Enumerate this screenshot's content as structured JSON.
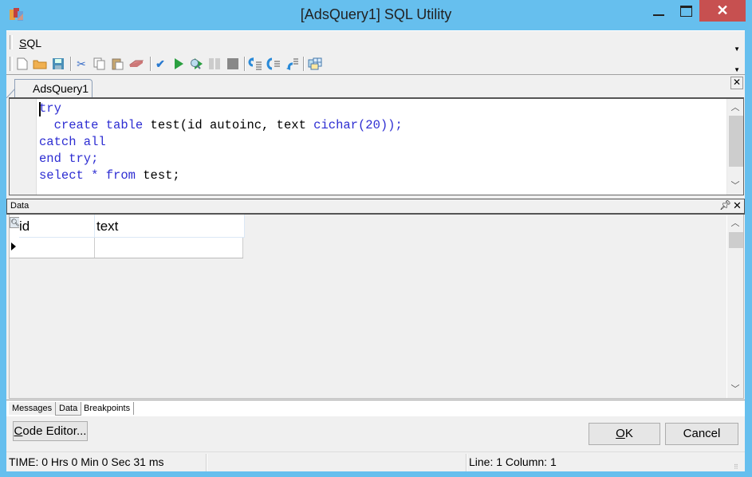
{
  "window": {
    "title": "[AdsQuery1] SQL Utility",
    "controls": {
      "minimize": "minimize",
      "maximize": "maximize",
      "close": "✕"
    }
  },
  "menu": {
    "sql_label": "SQL",
    "sql_accel": "S",
    "sql_rest": "QL"
  },
  "toolbar": {
    "groups": [
      [
        "new-file",
        "open-folder",
        "save"
      ],
      [
        "cut",
        "copy",
        "paste",
        "eraser"
      ],
      [
        "verify",
        "run",
        "run-debug",
        "pause",
        "stop"
      ],
      [
        "step-into",
        "step-over",
        "step-out"
      ],
      [
        "table-grid"
      ]
    ]
  },
  "tabs": {
    "active": "AdsQuery1"
  },
  "editor": {
    "lines": [
      [
        {
          "t": "try",
          "k": true
        }
      ],
      [
        {
          "t": "  "
        },
        {
          "t": "create table",
          "k": true
        },
        {
          "t": " test(id autoinc, text "
        },
        {
          "t": "cichar(20));",
          "k": true
        }
      ],
      [
        {
          "t": "catch all",
          "k": true
        }
      ],
      [
        {
          "t": "end try;",
          "k": true
        }
      ],
      [
        {
          "t": "select * from",
          "k": true
        },
        {
          "t": " test;"
        }
      ]
    ]
  },
  "data_panel": {
    "title": "Data",
    "columns": [
      "id",
      "text"
    ],
    "rows": [
      [
        "",
        ""
      ]
    ]
  },
  "bottom_tabs": [
    "Messages",
    "Data",
    "Breakpoints"
  ],
  "buttons": {
    "code_editor": {
      "accel": "C",
      "rest": "ode Editor..."
    },
    "ok": {
      "accel": "O",
      "rest": "K"
    },
    "cancel": "Cancel"
  },
  "status": {
    "time": "TIME: 0 Hrs  0 Min  0 Sec  31 ms",
    "middle": "",
    "position": "Line: 1 Column: 1"
  }
}
